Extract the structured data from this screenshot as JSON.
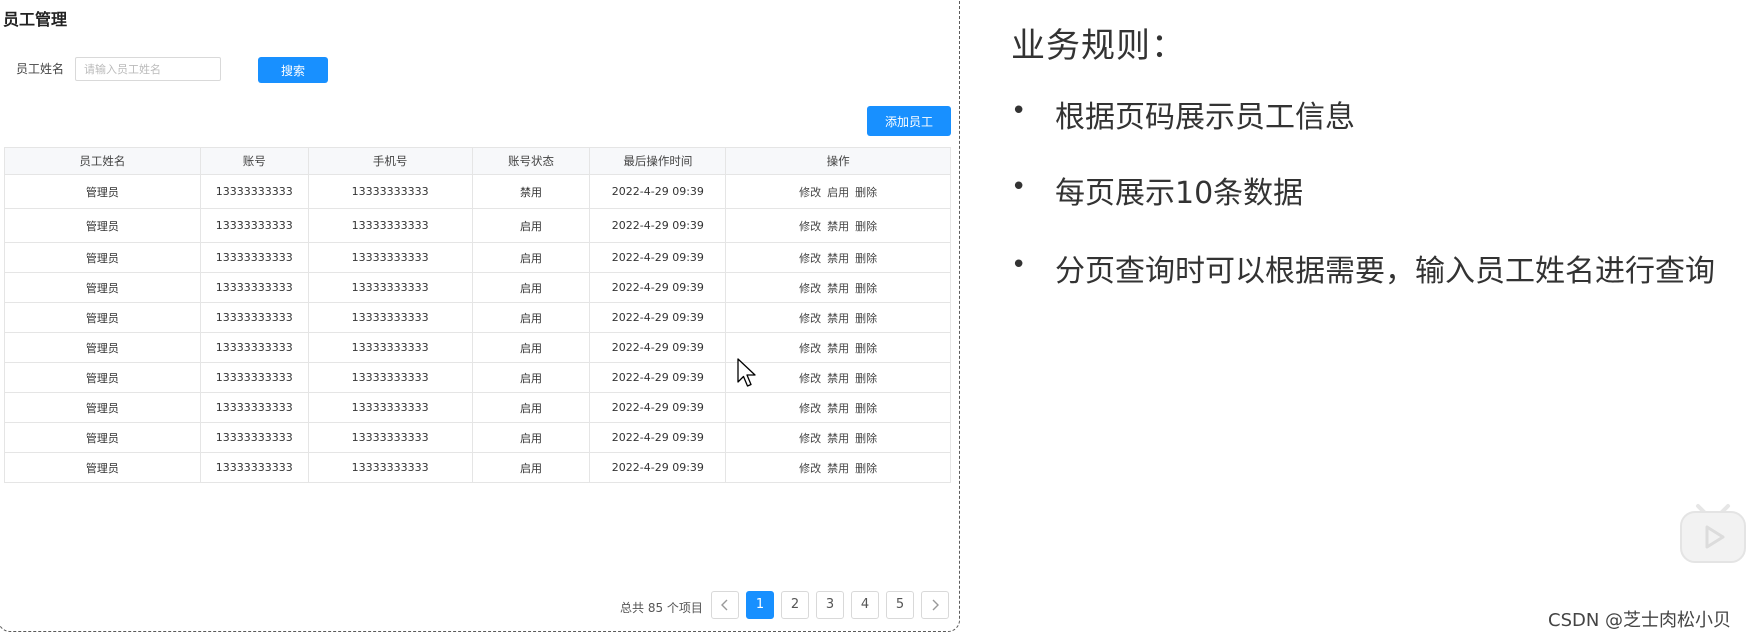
{
  "page": {
    "title": "员工管理",
    "search_label": "员工姓名",
    "search_placeholder": "请输入员工姓名",
    "search_button": "搜索",
    "add_button": "添加员工"
  },
  "table": {
    "columns": [
      "员工姓名",
      "账号",
      "手机号",
      "账号状态",
      "最后操作时间",
      "操作"
    ],
    "rows": [
      {
        "name": "管理员",
        "account": "13333333333",
        "phone": "13333333333",
        "status": "禁用",
        "time": "2022-4-29 09:39",
        "ops": [
          "修改",
          "启用",
          "删除"
        ]
      },
      {
        "name": "管理员",
        "account": "13333333333",
        "phone": "13333333333",
        "status": "启用",
        "time": "2022-4-29 09:39",
        "ops": [
          "修改",
          "禁用",
          "删除"
        ]
      },
      {
        "name": "管理员",
        "account": "13333333333",
        "phone": "13333333333",
        "status": "启用",
        "time": "2022-4-29 09:39",
        "ops": [
          "修改",
          "禁用",
          "删除"
        ]
      },
      {
        "name": "管理员",
        "account": "13333333333",
        "phone": "13333333333",
        "status": "启用",
        "time": "2022-4-29 09:39",
        "ops": [
          "修改",
          "禁用",
          "删除"
        ]
      },
      {
        "name": "管理员",
        "account": "13333333333",
        "phone": "13333333333",
        "status": "启用",
        "time": "2022-4-29 09:39",
        "ops": [
          "修改",
          "禁用",
          "删除"
        ]
      },
      {
        "name": "管理员",
        "account": "13333333333",
        "phone": "13333333333",
        "status": "启用",
        "time": "2022-4-29 09:39",
        "ops": [
          "修改",
          "禁用",
          "删除"
        ]
      },
      {
        "name": "管理员",
        "account": "13333333333",
        "phone": "13333333333",
        "status": "启用",
        "time": "2022-4-29 09:39",
        "ops": [
          "修改",
          "禁用",
          "删除"
        ]
      },
      {
        "name": "管理员",
        "account": "13333333333",
        "phone": "13333333333",
        "status": "启用",
        "time": "2022-4-29 09:39",
        "ops": [
          "修改",
          "禁用",
          "删除"
        ]
      },
      {
        "name": "管理员",
        "account": "13333333333",
        "phone": "13333333333",
        "status": "启用",
        "time": "2022-4-29 09:39",
        "ops": [
          "修改",
          "禁用",
          "删除"
        ]
      },
      {
        "name": "管理员",
        "account": "13333333333",
        "phone": "13333333333",
        "status": "启用",
        "time": "2022-4-29 09:39",
        "ops": [
          "修改",
          "禁用",
          "删除"
        ]
      }
    ]
  },
  "pagination": {
    "total_text": "总共 85 个项目",
    "prev_icon": "chevron-left-icon",
    "next_icon": "chevron-right-icon",
    "pages": [
      "1",
      "2",
      "3",
      "4",
      "5"
    ],
    "current_page": "1"
  },
  "rules": {
    "title": "业务规则：",
    "bullet": "•",
    "items": [
      "根据页码展示员工信息",
      "每页展示10条数据",
      "分页查询时可以根据需要，输入员工姓名进行查询"
    ]
  },
  "watermark": "CSDN @芝士肉松小贝",
  "colors": {
    "primary": "#1890ff",
    "header_bg": "#f7f8fa",
    "border": "#e5e5e5"
  }
}
